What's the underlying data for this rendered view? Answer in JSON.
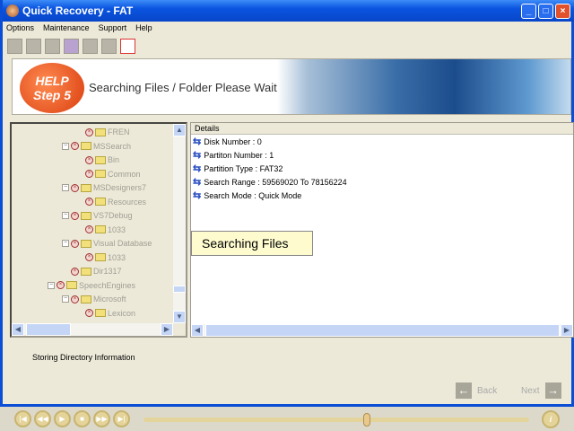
{
  "window": {
    "title": "Quick Recovery - FAT",
    "min": "_",
    "max": "□",
    "close": "×"
  },
  "menu": [
    "Options",
    "Maintenance",
    "Support",
    "Help"
  ],
  "banner": {
    "help_line1": "HELP",
    "help_line2": "Step 5",
    "message": "Searching Files / Folder Please Wait"
  },
  "tree": [
    {
      "label": "FREN",
      "depth": 3,
      "expander": false
    },
    {
      "label": "MSSearch",
      "depth": 2,
      "expander": true
    },
    {
      "label": "Bin",
      "depth": 3,
      "expander": false
    },
    {
      "label": "Common",
      "depth": 3,
      "expander": false
    },
    {
      "label": "MSDesigners7",
      "depth": 2,
      "expander": true
    },
    {
      "label": "Resources",
      "depth": 3,
      "expander": false
    },
    {
      "label": "VS7Debug",
      "depth": 2,
      "expander": true
    },
    {
      "label": "1033",
      "depth": 3,
      "expander": false
    },
    {
      "label": "Visual Database",
      "depth": 2,
      "expander": true
    },
    {
      "label": "1033",
      "depth": 3,
      "expander": false
    },
    {
      "label": "Dir1317",
      "depth": 2,
      "expander": false
    },
    {
      "label": "SpeechEngines",
      "depth": 1,
      "expander": true
    },
    {
      "label": "Microsoft",
      "depth": 2,
      "expander": true
    },
    {
      "label": "Lexicon",
      "depth": 3,
      "expander": false
    }
  ],
  "details": {
    "header": "Details",
    "rows": [
      "Disk Number : 0",
      "Partiton Number : 1",
      "Partition Type : FAT32",
      "Search Range : 59569020 To 78156224",
      "Search Mode : Quick Mode"
    ],
    "tooltip": "Searching Files"
  },
  "status": "Storing Directory Information",
  "nav": {
    "back": "Back",
    "next": "Next"
  },
  "player": {
    "progress": 0.58
  }
}
